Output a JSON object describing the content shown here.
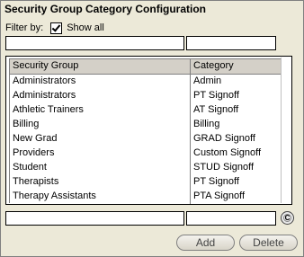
{
  "title": "Security Group Category Configuration",
  "filter": {
    "label": "Filter by:",
    "show_all_label": "Show all",
    "show_all_checked": true,
    "group_value": "",
    "category_value": ""
  },
  "grid": {
    "columns": [
      "Security Group",
      "Category"
    ],
    "rows": [
      [
        "Administrators",
        "Admin"
      ],
      [
        "Administrators",
        "PT Signoff"
      ],
      [
        "Athletic Trainers",
        "AT Signoff"
      ],
      [
        "Billing",
        "Billing"
      ],
      [
        "New Grad",
        "GRAD Signoff"
      ],
      [
        "Providers",
        "Custom Signoff"
      ],
      [
        "Student",
        "STUD Signoff"
      ],
      [
        "Therapists",
        "PT Signoff"
      ],
      [
        "Therapy Assistants",
        "PTA Signoff"
      ]
    ]
  },
  "entry": {
    "group_value": "",
    "category_value": "",
    "icon": "clear-icon",
    "icon_text": "C"
  },
  "buttons": {
    "add": "Add",
    "delete": "Delete"
  }
}
